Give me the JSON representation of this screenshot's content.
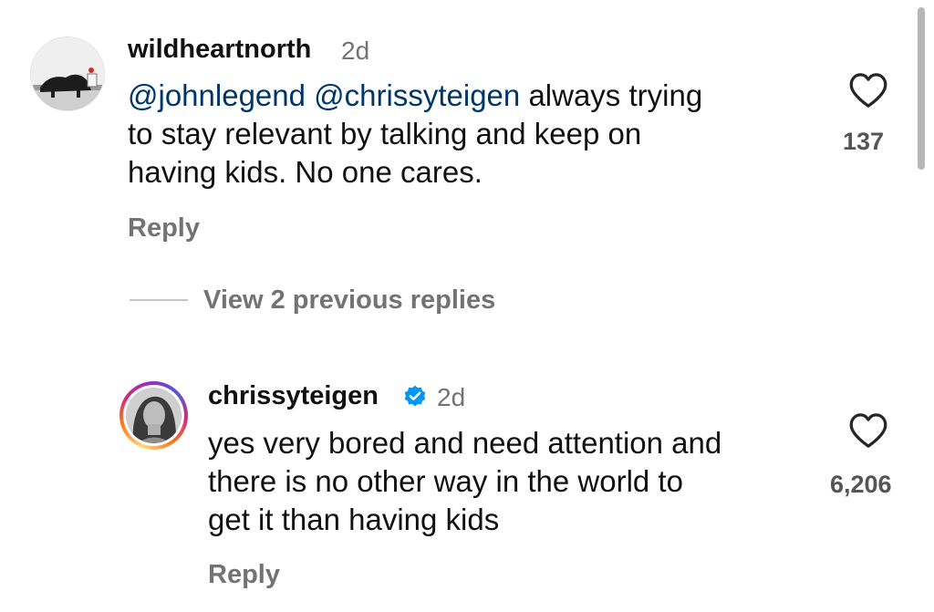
{
  "comments": [
    {
      "username": "wildheartnorth",
      "time": "2d",
      "mention1": "@johnlegend",
      "mention2": "@chrissyteigen",
      "text_line1": "always trying",
      "text_line2": "to stay relevant by talking and keep on",
      "text_line3": "having kids. No one cares.",
      "likes": "137",
      "reply_label": "Reply",
      "avatar_icon": "profile-photo",
      "heart_icon": "heart-outline-icon"
    },
    {
      "username": "chrissyteigen",
      "verified_icon": "verified-badge-icon",
      "time": "2d",
      "text_line1": "yes very bored and need attention and",
      "text_line2": "there is no other way in the world to",
      "text_line3": "get it than having kids",
      "likes": "6,206",
      "reply_label": "Reply",
      "avatar_icon": "profile-photo-story-ring",
      "heart_icon": "heart-outline-icon"
    }
  ],
  "thread": {
    "view_replies_label": "View 2 previous replies"
  },
  "colors": {
    "mention": "#00376b",
    "secondary_text": "#737373",
    "verified": "#0095f6",
    "primary_text": "#111111"
  }
}
